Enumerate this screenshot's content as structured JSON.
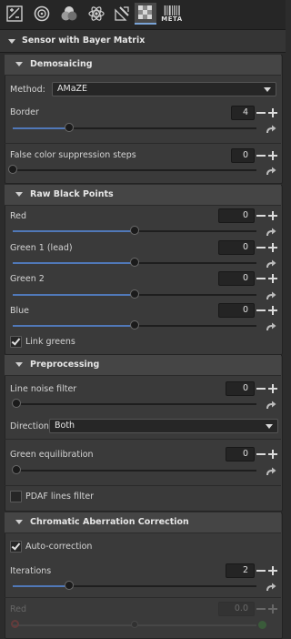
{
  "toolbar": {
    "tools": [
      {
        "name": "exposure-tab-icon"
      },
      {
        "name": "detail-tab-icon"
      },
      {
        "name": "color-tab-icon"
      },
      {
        "name": "advanced-tab-icon"
      },
      {
        "name": "transform-tab-icon"
      },
      {
        "name": "raw-tab-icon",
        "active": true
      },
      {
        "name": "metadata-tab-icon"
      }
    ],
    "meta_label": "META"
  },
  "sensor": {
    "title": "Sensor with Bayer Matrix"
  },
  "demosaicing": {
    "title": "Demosaicing",
    "method_label": "Method:",
    "method_value": "AMaZE",
    "border_label": "Border",
    "border_value": "4",
    "border_fraction": 0.23,
    "fcs_label": "False color suppression steps",
    "fcs_value": "0",
    "fcs_fraction": 0.0
  },
  "black_points": {
    "title": "Raw Black Points",
    "red_label": "Red",
    "red_value": "0",
    "green1_label": "Green 1 (lead)",
    "green1_value": "0",
    "green2_label": "Green 2",
    "green2_value": "0",
    "blue_label": "Blue",
    "blue_value": "0",
    "slider_fraction": 0.5,
    "link_greens_label": "Link greens",
    "link_greens_checked": true
  },
  "preprocessing": {
    "title": "Preprocessing",
    "line_noise_label": "Line noise filter",
    "line_noise_value": "0",
    "direction_label": "Direction:",
    "direction_value": "Both",
    "green_eq_label": "Green equilibration",
    "green_eq_value": "0",
    "pdaf_label": "PDAF lines filter",
    "pdaf_checked": false
  },
  "ca_correction": {
    "title": "Chromatic Aberration Correction",
    "auto_label": "Auto-correction",
    "auto_checked": true,
    "iterations_label": "Iterations",
    "iterations_value": "2",
    "iterations_fraction": 0.23,
    "red_label": "Red",
    "red_value": "0.0"
  },
  "colors": {
    "accent": "#5078b8",
    "panel": "#3a3a3a",
    "background": "#2c2c2c"
  }
}
